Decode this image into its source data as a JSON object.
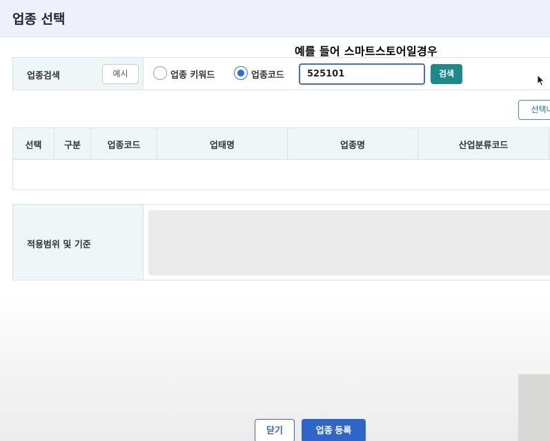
{
  "dialog": {
    "title": "업종 선택"
  },
  "caption": "예를 들어 스마트스토어일경우",
  "search": {
    "label": "업종검색",
    "example_button": "예시",
    "radio_keyword_label": "업종 키워드",
    "radio_code_label": "업종코드",
    "selected_mode": "업종코드",
    "code_value": "525101",
    "search_button": "검색",
    "select_button": "선택내"
  },
  "table": {
    "columns": [
      "선택",
      "구분",
      "업종코드",
      "업태명",
      "업종명",
      "산업분류코드"
    ],
    "rows": []
  },
  "scope": {
    "label": "적용범위 및 기준"
  },
  "footer": {
    "close_button": "닫기",
    "register_button": "업종 등록"
  },
  "colors": {
    "accent_blue": "#2f66c9",
    "search_teal": "#1a8a8a",
    "header_bg": "#eef6f7"
  }
}
